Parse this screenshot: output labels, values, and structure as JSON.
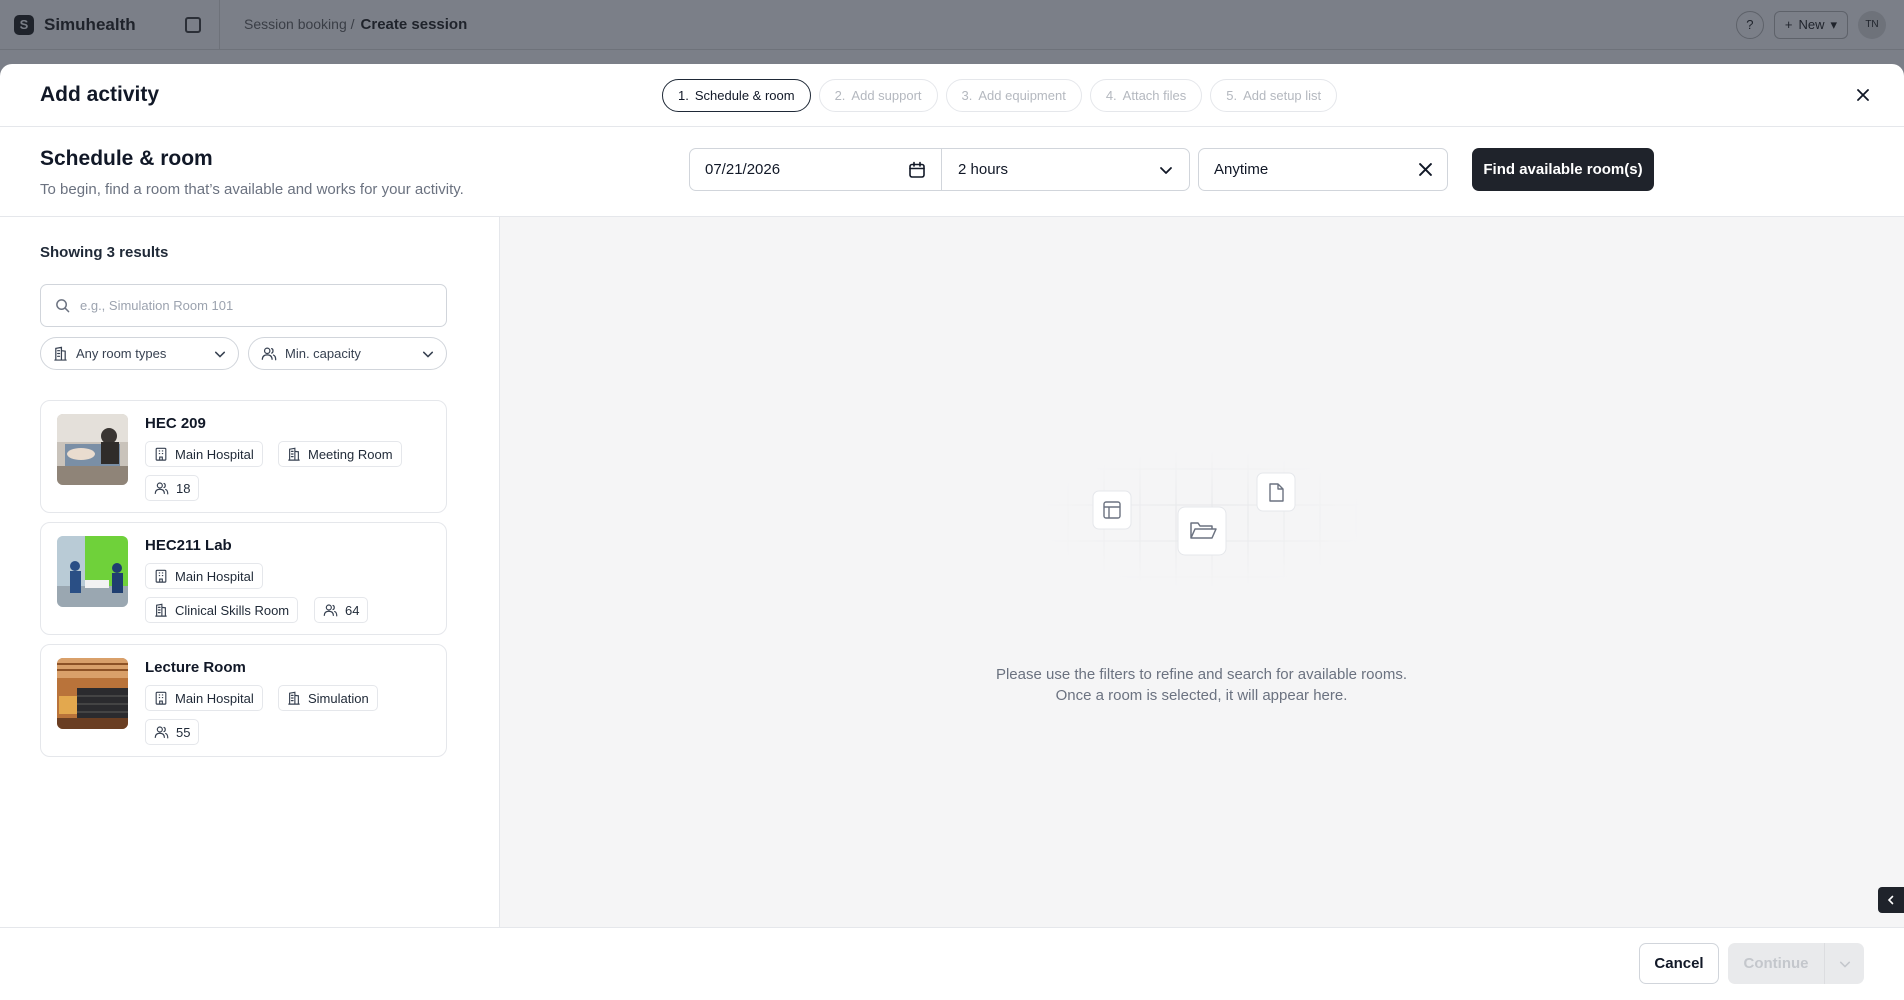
{
  "app": {
    "brand": "Simuhealth",
    "breadcrumb_parent": "Session booking /",
    "breadcrumb_current": "Create session",
    "new_label": "New",
    "avatar_initials": "TN"
  },
  "modal": {
    "title": "Add activity",
    "steps": [
      {
        "num": "1.",
        "label": "Schedule & room",
        "active": true
      },
      {
        "num": "2.",
        "label": "Add support",
        "active": false
      },
      {
        "num": "3.",
        "label": "Add equipment",
        "active": false
      },
      {
        "num": "4.",
        "label": "Attach files",
        "active": false
      },
      {
        "num": "5.",
        "label": "Add setup list",
        "active": false
      }
    ]
  },
  "section": {
    "title": "Schedule & room",
    "subtitle": "To begin, find a room that’s available and works for your activity.",
    "date_value": "07/21/2026",
    "duration_value": "2 hours",
    "time_value": "Anytime",
    "find_label": "Find available room(s)"
  },
  "results": {
    "count_label": "Showing 3 results",
    "search_placeholder": "e.g., Simulation Room 101",
    "room_type_filter": "Any room types",
    "capacity_filter": "Min. capacity",
    "rooms": [
      {
        "name": "HEC 209",
        "building": "Main Hospital",
        "type": "Meeting Room",
        "capacity": "18"
      },
      {
        "name": "HEC211 Lab",
        "building": "Main Hospital",
        "type": "Clinical Skills Room",
        "capacity": "64"
      },
      {
        "name": "Lecture Room",
        "building": "Main Hospital",
        "type": "Simulation",
        "capacity": "55"
      }
    ]
  },
  "empty_state": {
    "line1": "Please use the filters to refine and search for available rooms.",
    "line2": "Once a room is selected, it will appear here."
  },
  "footer": {
    "cancel_label": "Cancel",
    "continue_label": "Continue"
  },
  "colors": {
    "primary": "#1f232b",
    "overlay": "#7b7f88",
    "muted_text": "#6b7280",
    "border": "#e5e7eb"
  }
}
